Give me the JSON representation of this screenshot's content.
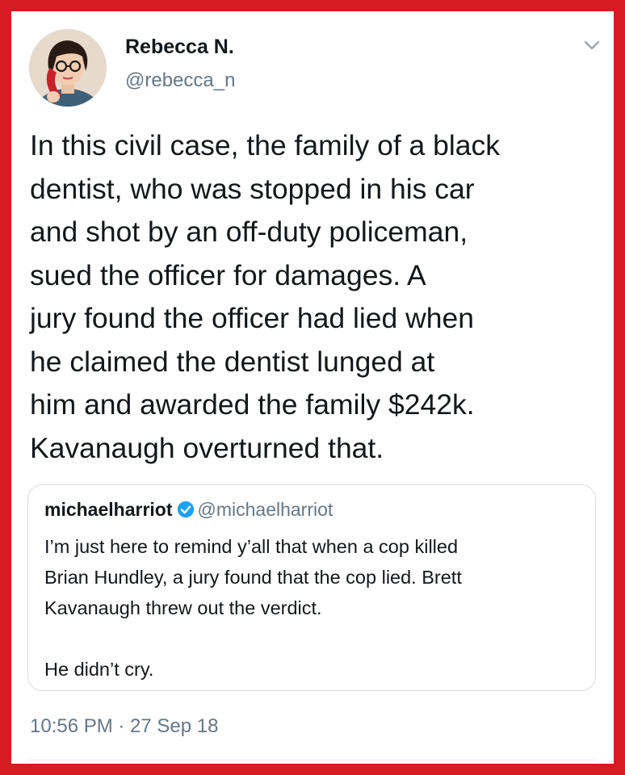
{
  "tweet": {
    "display_name": "Rebecca N.",
    "handle": "@rebecca_n",
    "avatar_icon": "avatar-woman-glasses-phone",
    "menu_icon": "chevron-down-icon",
    "text": "In this civil case, the family of a black\ndentist, who was stopped in his car\nand shot by an off-duty policeman,\nsued the officer for damages. A\njury found the officer had lied when\nhe claimed the dentist lunged at\nhim and awarded the family $242k.\nKavanaugh overturned that.",
    "timestamp": "10:56 PM · 27 Sep 18"
  },
  "quoted_tweet": {
    "display_name": "michaelharriot",
    "verified": true,
    "handle": "@michaelharriot",
    "text": "I’m just here to remind y’all that when a cop killed\nBrian Hundley, a jury found that the cop lied. Brett\nKavanaugh threw out the verdict.\n\nHe didn’t cry."
  },
  "colors": {
    "frame": "#d41c22",
    "verified_badge": "#1da1f2",
    "secondary_text": "#657786",
    "primary_text": "#14171a"
  }
}
